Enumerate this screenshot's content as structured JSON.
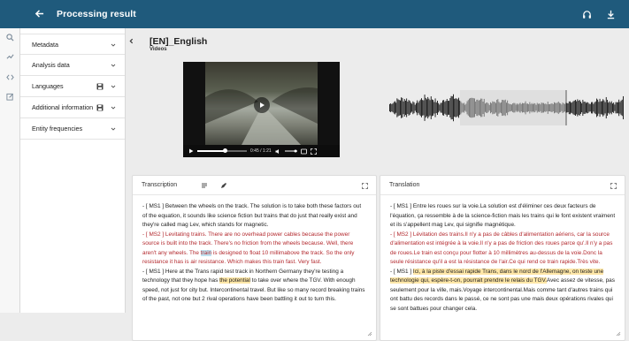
{
  "topbar": {
    "title": "Processing result",
    "back_icon": "arrow-left-icon",
    "right_icons": [
      "headphones-icon",
      "download-icon"
    ],
    "color": "#1f5a7c"
  },
  "rail": {
    "icons": [
      "search-icon",
      "trend-icon",
      "code-icon",
      "edit-icon"
    ]
  },
  "sidebar": {
    "items": [
      {
        "label": "Metadata"
      },
      {
        "label": "Analysis data"
      },
      {
        "label": "Languages",
        "extra_icon": "save-icon"
      },
      {
        "label": "Additional information",
        "extra_icon": "save-icon"
      },
      {
        "label": "Entity frequencies"
      }
    ]
  },
  "document": {
    "title": "[EN]_English",
    "subtitle": "Videos"
  },
  "video": {
    "time": "0:45 / 1:21",
    "progress": 0.56
  },
  "transcription": {
    "title": "Transcription",
    "segments": [
      {
        "before": "- [ MS1 ] Between the wheels on the track. The solution is to take both these factors out of the equation, it sounds like science fiction but trains that do just that really exist and they're called mag Lev, which stands for magnetic.",
        "highlight": "",
        "after": "",
        "color": "normal"
      },
      {
        "before": "- [ MS2 ] Levitating trains. There are no overhead power cables because the power source is built into the track. There's no friction from the wheels because. Well, there aren't any wheels. The ",
        "highlight": "train",
        "after": " is designed to float 10 millimabove the track. So the only resistance it has is air resistance. Which makes this train fast. Very fast.",
        "color": "red"
      },
      {
        "before": "- [ MS1 ] Here at the Trans rapid test track in Northern Germany they're testing a technology that they hope has ",
        "highlight": "the potential",
        "after": " to take over where the TGV. With enough speed, not just for city but. Intercontinental travel. But like so many record breaking trains of the past, not one but 2 rival operations have been battling it out to turn this.",
        "color": "normal"
      }
    ]
  },
  "translation": {
    "title": "Translation",
    "segments": [
      {
        "before": "- [ MS1 ] Entre les roues sur la voie.La solution est d'éliminer ces deux facteurs de l'équation, ça ressemble à de la science-fiction mais les trains qui le font existent vraiment et ils s'appellent mag Lev, qui signifie magnétique.",
        "highlight": "",
        "after": "",
        "color": "normal"
      },
      {
        "before": "- [ MS2 ] Lévitation des trains.Il n'y a pas de câbles d'alimentation aériens, car la source d'alimentation est intégrée à la voie.Il n'y a pas de friction des roues parce qu'.Il n'y a pas de roues.Le train est conçu pour flotter à 10 millimètres au-dessus de la voie.Donc la seule résistance qu'il a est la résistance de l'air.Ce qui rend ce train rapide.Très vite.",
        "highlight": "",
        "after": "",
        "color": "red"
      },
      {
        "before": "- [ MS1 ] ",
        "highlight": "Ici, à la piste d'essai rapide Trans, dans le nord de l'Allemagne, on teste une technologie qui, espère-t-on, pourrait prendre le relais du TGV.",
        "after": "Avec assez de vitesse, pas seulement pour la ville, mais.Voyage intercontinental.Mais comme tant d'autres trains qui ont battu des records dans le passé, ce ne sont pas une mais deux opérations rivales qui se sont battues pour changer cela.",
        "color": "normal"
      }
    ]
  }
}
